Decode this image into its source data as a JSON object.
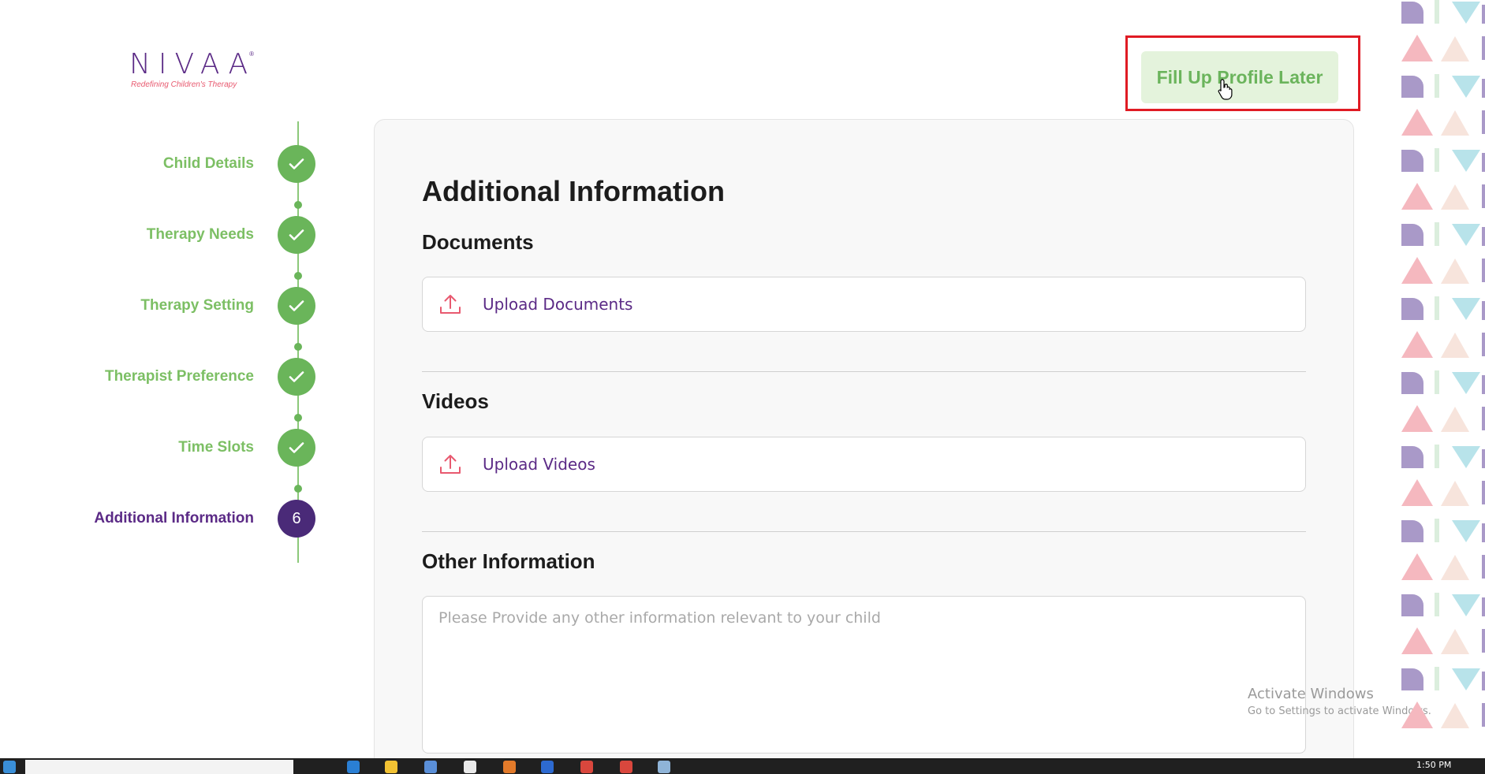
{
  "brand": {
    "name": "NIVAA",
    "tagline": "Redefining Children's Therapy",
    "registered": "®"
  },
  "header": {
    "fill_later_label": "Fill Up Profile Later"
  },
  "stepper": {
    "steps": [
      {
        "label": "Child Details",
        "status": "completed"
      },
      {
        "label": "Therapy Needs",
        "status": "completed"
      },
      {
        "label": "Therapy Setting",
        "status": "completed"
      },
      {
        "label": "Therapist Preference",
        "status": "completed"
      },
      {
        "label": "Time Slots",
        "status": "completed"
      },
      {
        "label": "Additional Information",
        "status": "active",
        "number": "6"
      }
    ]
  },
  "form": {
    "title": "Additional Information",
    "documents": {
      "heading": "Documents",
      "upload_label": "Upload Documents"
    },
    "videos": {
      "heading": "Videos",
      "upload_label": "Upload Videos"
    },
    "other": {
      "heading": "Other Information",
      "placeholder": "Please Provide any other information relevant to your child",
      "value": ""
    }
  },
  "watermark": {
    "title": "Activate Windows",
    "subtitle": "Go to Settings to activate Windows."
  },
  "taskbar": {
    "time": "1:50 PM"
  },
  "colors": {
    "brand_purple": "#5b2a86",
    "brand_pink": "#e8596f",
    "step_green": "#6ab55a",
    "button_bg": "#e4f3dc",
    "highlight_red": "#e01b24"
  }
}
